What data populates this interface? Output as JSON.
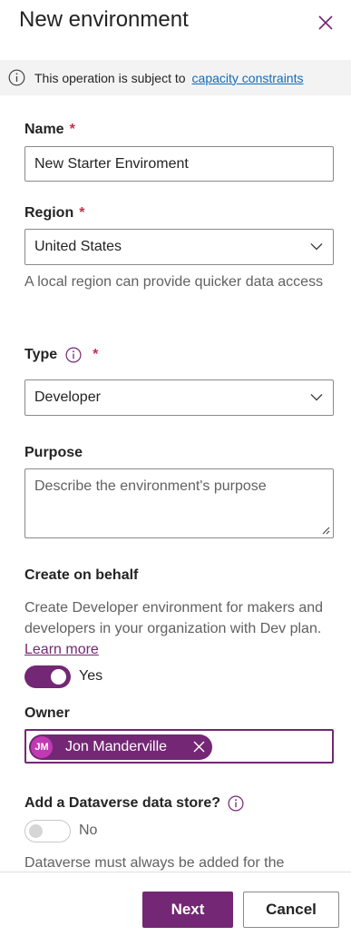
{
  "panel": {
    "title": "New environment"
  },
  "banner": {
    "text": "This operation is subject to",
    "link": "capacity constraints"
  },
  "name_field": {
    "label": "Name",
    "required_mark": "*",
    "value": "New  Starter Enviroment"
  },
  "region_field": {
    "label": "Region",
    "required_mark": "*",
    "value": "United States",
    "hint": "A local region can provide quicker data access"
  },
  "type_field": {
    "label": "Type",
    "required_mark": "*",
    "value": "Developer"
  },
  "purpose_field": {
    "label": "Purpose",
    "placeholder": "Describe the environment's purpose"
  },
  "create_on_behalf": {
    "label": "Create on behalf",
    "description": "Create Developer environment for makers and developers in your organization with Dev plan.",
    "link": "Learn more",
    "toggle_on": true,
    "toggle_label": "Yes"
  },
  "owner": {
    "label": "Owner",
    "initials": "JM",
    "name": "Jon Manderville"
  },
  "dataverse": {
    "label": "Add a Dataverse data store?",
    "toggle_on": false,
    "toggle_label": "No",
    "note": "Dataverse must always be added for the"
  },
  "footer": {
    "next": "Next",
    "cancel": "Cancel"
  },
  "colors": {
    "accent": "#742774",
    "required": "#c4314b",
    "link": "#0f6cbd"
  }
}
